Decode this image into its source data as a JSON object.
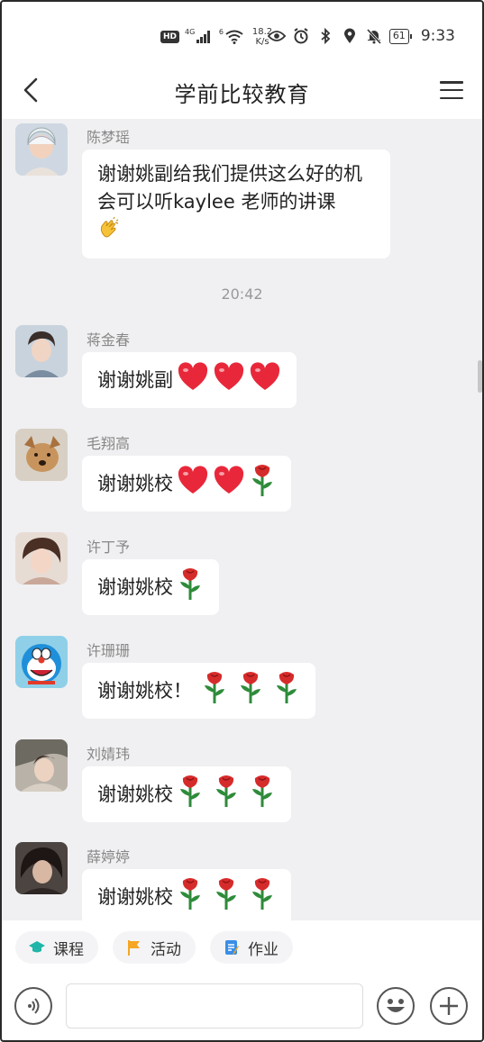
{
  "status_bar": {
    "hd": "HD",
    "net1": "4G",
    "net2": "6",
    "speed_value": "18.2",
    "speed_unit": "K/s",
    "battery": "61",
    "time": "9:33"
  },
  "header": {
    "title": "学前比较教育"
  },
  "chat": {
    "messages": [
      {
        "sender": "陈梦瑶",
        "text": "谢谢姚副给我们提供这么好的机会可以听kaylee 老师的讲课",
        "emojis": [
          "clap"
        ]
      },
      {
        "sender": "蒋金春",
        "text": "谢谢姚副",
        "emojis": [
          "heart",
          "heart",
          "heart"
        ]
      },
      {
        "sender": "毛翔高",
        "text": "谢谢姚校",
        "emojis": [
          "heart",
          "heart",
          "rose"
        ]
      },
      {
        "sender": "许丁予",
        "text": "谢谢姚校",
        "emojis": [
          "rose"
        ]
      },
      {
        "sender": "许珊珊",
        "text": "谢谢姚校！",
        "emojis": [
          "rose",
          "rose",
          "rose"
        ]
      },
      {
        "sender": "刘婧玮",
        "text": "谢谢姚校",
        "emojis": [
          "rose",
          "rose",
          "rose"
        ]
      },
      {
        "sender": "薛婷婷",
        "text": "谢谢姚校",
        "emojis": [
          "rose",
          "rose",
          "rose"
        ]
      }
    ],
    "time_separator": "20:42"
  },
  "quick_actions": [
    {
      "label": "课程",
      "icon": "graduation-cap-icon",
      "color": "#1fb5a8"
    },
    {
      "label": "活动",
      "icon": "flag-icon",
      "color": "#f5a623"
    },
    {
      "label": "作业",
      "icon": "homework-icon",
      "color": "#3a8ee6"
    }
  ],
  "input": {
    "placeholder": ""
  },
  "colors": {
    "chat_bg": "#f0f0f2",
    "heart": "#e8283a",
    "rose": "#d62b2b",
    "stem": "#2e8b3a"
  }
}
